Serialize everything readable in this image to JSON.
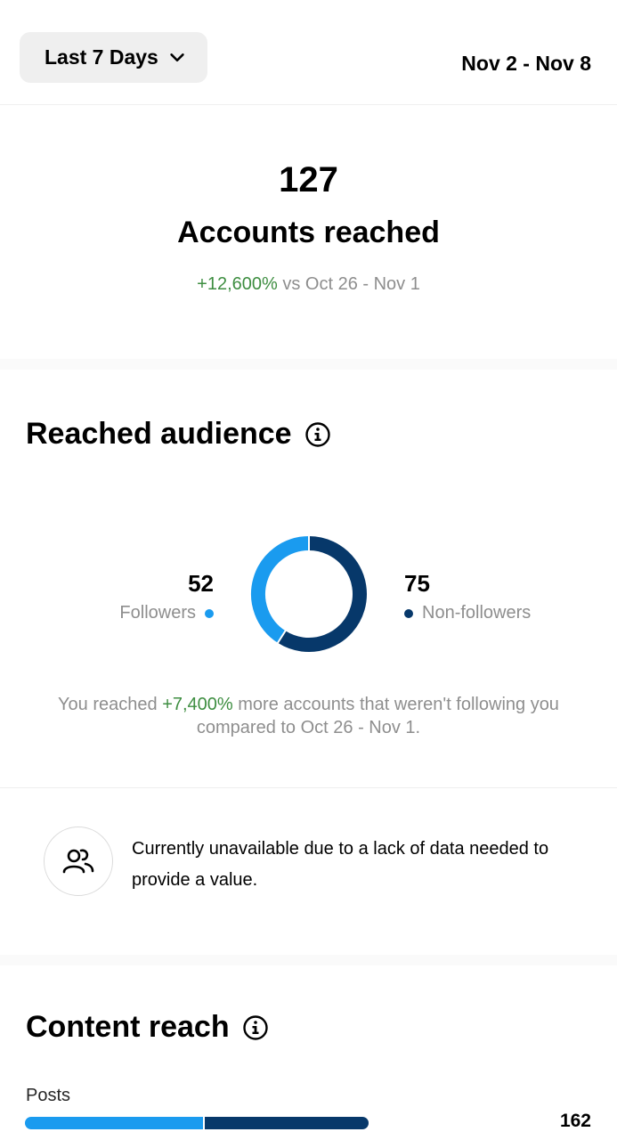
{
  "header": {
    "range_label": "Last 7 Days",
    "date_range": "Nov 2 - Nov 8"
  },
  "summary": {
    "count": "127",
    "label": "Accounts reached",
    "change": "+12,600%",
    "compare_text": " vs Oct 26 - Nov 1"
  },
  "audience": {
    "title": "Reached audience",
    "followers_count": "52",
    "followers_label": "Followers",
    "nonfollowers_count": "75",
    "nonfollowers_label": "Non-followers",
    "note_prefix": "You reached ",
    "note_change": "+7,400%",
    "note_suffix": " more accounts that weren't following you compared to Oct 26 - Nov 1.",
    "unavailable_text": "Currently unavailable due to a lack of data needed to provide a value."
  },
  "colors": {
    "followers": "#1a9bef",
    "nonfollowers": "#07386a",
    "positive": "#3e8e41"
  },
  "chart_data": {
    "type": "pie",
    "categories": [
      "Followers",
      "Non-followers"
    ],
    "values": [
      52,
      75
    ]
  },
  "content_reach": {
    "title": "Content reach",
    "posts_label": "Posts",
    "posts_value": "162",
    "posts_followers_fraction": 0.52
  }
}
